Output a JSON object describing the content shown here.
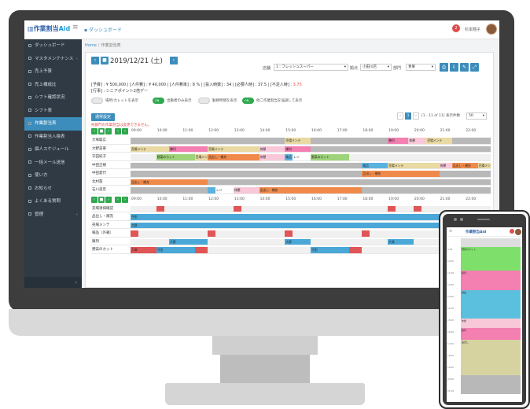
{
  "app": {
    "logo_text": "作業割当",
    "logo_suffix": "Aid",
    "top_tab": "ダッシュボード",
    "notification_count": "2",
    "user_name": "杉本翔子"
  },
  "sidebar": {
    "items": [
      {
        "label": "ダッシュボード",
        "arrow": ""
      },
      {
        "label": "マスタメンテナンス",
        "arrow": "‹"
      },
      {
        "label": "売上予算",
        "arrow": ""
      },
      {
        "label": "売上構成比",
        "arrow": ""
      },
      {
        "label": "シフト確認状況",
        "arrow": ""
      },
      {
        "label": "シフト表",
        "arrow": ""
      },
      {
        "label": "作業割当表",
        "arrow": "",
        "active": true
      },
      {
        "label": "作業割当入換表",
        "arrow": ""
      },
      {
        "label": "個人スケジュール",
        "arrow": ""
      },
      {
        "label": "一括メール送信",
        "arrow": ""
      },
      {
        "label": "使い方",
        "arrow": ""
      },
      {
        "label": "お知らせ",
        "arrow": ""
      },
      {
        "label": "よくある質問",
        "arrow": ""
      },
      {
        "label": "管理",
        "arrow": "‹"
      }
    ],
    "collapse_icon": "‹"
  },
  "breadcrumb": {
    "home": "Home",
    "separator": "/",
    "current": "作業割当表"
  },
  "date_nav": {
    "prev": "‹",
    "today": "■",
    "date": "2019/12/21 (土)",
    "next": "›"
  },
  "filters": {
    "store_label": "店舗",
    "store_value": "1 : フレッシュスーパー",
    "section_label": "拠点",
    "section_value": "小田川店",
    "dept_label": "部門",
    "dept_value": "青果"
  },
  "summary": {
    "line1_a": "[予算] : ¥ 500,000 | [人件費] : ¥ 40,000 | [人件費率] : 8 % | [投入時数] : 34 | [必要人時] : 37.5 | [不足人時] : ",
    "line1_warn": "3.75",
    "line2": "[行事] : シニアポイント2倍デー"
  },
  "toggles": [
    {
      "label": "場所/カレットを表示",
      "state": ""
    },
    {
      "label": "出勤者のみ表示",
      "state": "ON"
    },
    {
      "label": "勤務時間を表示",
      "state": ""
    },
    {
      "label": "他二作業割当を強調して表示",
      "state": "ON"
    }
  ],
  "register_button": "通常設定",
  "pager": {
    "prev": "‹",
    "page": "1",
    "next": "›",
    "info": "[1 - 11 of 11] 表示件数",
    "size": "50"
  },
  "note": "他部門の作業割当は変更できません。",
  "times": [
    "09:00",
    "10:00",
    "11:00",
    "12:00",
    "13:00",
    "14:00",
    "15:00",
    "16:00",
    "17:00",
    "18:00",
    "19:00",
    "20:00",
    "21:00",
    "22:00"
  ],
  "staff_rows": [
    {
      "name": "大塚聡広",
      "gray": true,
      "segs": [
        {
          "s": 6.0,
          "e": 7.0,
          "c": "#e9d9a2",
          "t": "売場メンテ"
        },
        {
          "s": 10.0,
          "e": 10.8,
          "c": "#f47fb1",
          "t": "陳列"
        },
        {
          "s": 10.8,
          "e": 11.5,
          "c": "#f8c8d8",
          "t": "休憩"
        },
        {
          "s": 11.5,
          "e": 12.5,
          "c": "#e9d9a2",
          "t": "売場メンテ"
        }
      ]
    },
    {
      "name": "大野美東",
      "gray": false,
      "segs": [
        {
          "s": 0,
          "e": 1.5,
          "c": "#e9d9a2",
          "t": "売場メンテ"
        },
        {
          "s": 1.5,
          "e": 3.0,
          "c": "#f47fb1",
          "t": "陳列"
        },
        {
          "s": 3.0,
          "e": 5.0,
          "c": "#e9d9a2",
          "t": "売場メンテ"
        },
        {
          "s": 5.0,
          "e": 6.0,
          "c": "#f8c8d8",
          "t": "休憩"
        },
        {
          "s": 6.0,
          "e": 7.0,
          "c": "#f47fb1",
          "t": "陳列"
        },
        {
          "s": 7.0,
          "e": 14.0,
          "c": "#b8b8b8",
          "t": ""
        }
      ]
    },
    {
      "name": "守田紀子",
      "gray": false,
      "segs": [
        {
          "s": 1.0,
          "e": 2.5,
          "c": "#9ed37a",
          "t": "野菜のカット"
        },
        {
          "s": 2.5,
          "e": 3.0,
          "c": "#e9d9a2",
          "t": "売場メンテ"
        },
        {
          "s": 3.0,
          "e": 5.0,
          "c": "#f08a4b",
          "t": "品出し・補充"
        },
        {
          "s": 5.0,
          "e": 6.0,
          "c": "#f8c8d8",
          "t": "休憩"
        },
        {
          "s": 6.0,
          "e": 6.3,
          "c": "#5ab2e0",
          "t": "検品"
        },
        {
          "s": 6.3,
          "e": 7.0,
          "c": "#ffffff",
          "t": "レジ"
        },
        {
          "s": 7.0,
          "e": 8.5,
          "c": "#9ed37a",
          "t": "野菜のカット"
        }
      ]
    },
    {
      "name": "中田正樹",
      "gray": true,
      "segs": [
        {
          "s": 9.0,
          "e": 10.0,
          "c": "#5ab2e0",
          "t": "検品"
        },
        {
          "s": 10.0,
          "e": 12.0,
          "c": "#e9d9a2",
          "t": "売場メンテ"
        },
        {
          "s": 12.0,
          "e": 12.5,
          "c": "#f8c8d8",
          "t": "休憩"
        },
        {
          "s": 12.5,
          "e": 13.5,
          "c": "#f08a4b",
          "t": "品出し・補充"
        },
        {
          "s": 13.5,
          "e": 14.0,
          "c": "#e9d9a2",
          "t": "売場メンテ"
        }
      ]
    },
    {
      "name": "中田愛代",
      "gray": true,
      "segs": [
        {
          "s": 9.0,
          "e": 12.0,
          "c": "#f08a4b",
          "t": "品出し・補充"
        }
      ]
    },
    {
      "name": "北村茜",
      "gray": true,
      "segs": [
        {
          "s": 0,
          "e": 3.0,
          "c": "#f08a4b",
          "t": "品出し・補充"
        }
      ]
    },
    {
      "name": "石川美音",
      "gray": true,
      "segs": [
        {
          "s": 3.0,
          "e": 3.3,
          "c": "#5ab2e0",
          "t": ""
        },
        {
          "s": 3.3,
          "e": 4.0,
          "c": "#ffffff",
          "t": "レジ"
        },
        {
          "s": 4.0,
          "e": 5.0,
          "c": "#f8c8d8",
          "t": "休憩"
        },
        {
          "s": 5.0,
          "e": 9.0,
          "c": "#f08a4b",
          "t": "品出し・補充"
        }
      ]
    }
  ],
  "task_rows": [
    {
      "name": "売場清掃確認",
      "gray": false,
      "segs": [
        {
          "s": 1.0,
          "e": 1.3,
          "c": "#e05555",
          "t": ""
        },
        {
          "s": 4.0,
          "e": 4.3,
          "c": "#e05555",
          "t": ""
        },
        {
          "s": 10.0,
          "e": 10.3,
          "c": "#e05555",
          "t": ""
        },
        {
          "s": 11.0,
          "e": 11.3,
          "c": "#e05555",
          "t": ""
        }
      ]
    },
    {
      "name": "品出し・補充",
      "gray": false,
      "segs": [
        {
          "s": 0,
          "e": 14.0,
          "c": "#4aa8d8",
          "t": "守田"
        }
      ]
    },
    {
      "name": "売場メンテ",
      "gray": false,
      "segs": [
        {
          "s": 0,
          "e": 14.0,
          "c": "#4aa8d8",
          "t": "大野"
        }
      ]
    },
    {
      "name": "検品（外箱）",
      "gray": false,
      "segs": [
        {
          "s": 0,
          "e": 0.3,
          "c": "#e05555",
          "t": ""
        },
        {
          "s": 3.0,
          "e": 3.3,
          "c": "#e05555",
          "t": ""
        },
        {
          "s": 6.0,
          "e": 6.3,
          "c": "#e05555",
          "t": ""
        },
        {
          "s": 9.0,
          "e": 9.3,
          "c": "#e05555",
          "t": ""
        }
      ]
    },
    {
      "name": "陳列",
      "gray": false,
      "segs": [
        {
          "s": 1.5,
          "e": 3.0,
          "c": "#4aa8d8",
          "t": "大野"
        },
        {
          "s": 6.0,
          "e": 7.0,
          "c": "#4aa8d8",
          "t": "大野"
        },
        {
          "s": 10.0,
          "e": 11.0,
          "c": "#4aa8d8",
          "t": "大塚"
        }
      ]
    },
    {
      "name": "野菜のカット",
      "gray": false,
      "segs": [
        {
          "s": 0,
          "e": 1.0,
          "c": "#e05555",
          "t": "大塚"
        },
        {
          "s": 1.0,
          "e": 2.5,
          "c": "#4aa8d8",
          "t": "守田"
        },
        {
          "s": 2.5,
          "e": 3.0,
          "c": "#e05555",
          "t": ""
        },
        {
          "s": 7.0,
          "e": 8.5,
          "c": "#4aa8d8",
          "t": "守田"
        },
        {
          "s": 8.5,
          "e": 9.0,
          "c": "#e05555",
          "t": ""
        }
      ]
    }
  ],
  "phone": {
    "logo": "作業割当Aid",
    "ticks": [
      "9:00",
      "10:00",
      "11:00",
      "12:00",
      "13:00",
      "14:00",
      "15:00",
      "16:00",
      "17:00",
      "18:00",
      "19:00",
      "20:00",
      "21:00",
      "22:00"
    ],
    "blocks": [
      {
        "from": 0.0,
        "to": 0.7,
        "c": "#dddddd",
        "t": ""
      },
      {
        "from": 0.7,
        "to": 2.7,
        "c": "#7ee06a",
        "t": "野菜のカット"
      },
      {
        "from": 2.7,
        "to": 4.4,
        "c": "#f47fb1",
        "t": "陳列"
      },
      {
        "from": 4.4,
        "to": 6.8,
        "c": "#5bc0de",
        "t": "検品"
      },
      {
        "from": 6.8,
        "to": 7.6,
        "c": "#f8c8d8",
        "t": "休憩"
      },
      {
        "from": 7.6,
        "to": 8.6,
        "c": "#f47fb1",
        "t": "陳列"
      },
      {
        "from": 8.6,
        "to": 11.6,
        "c": "#d6d3a0",
        "t": "品出し"
      },
      {
        "from": 11.6,
        "to": 13.2,
        "c": "#b8b8b8",
        "t": ""
      }
    ]
  },
  "icons": {
    "top_dash_icon": "dashboard-icon",
    "hamburger_icon": "menu-icon"
  }
}
